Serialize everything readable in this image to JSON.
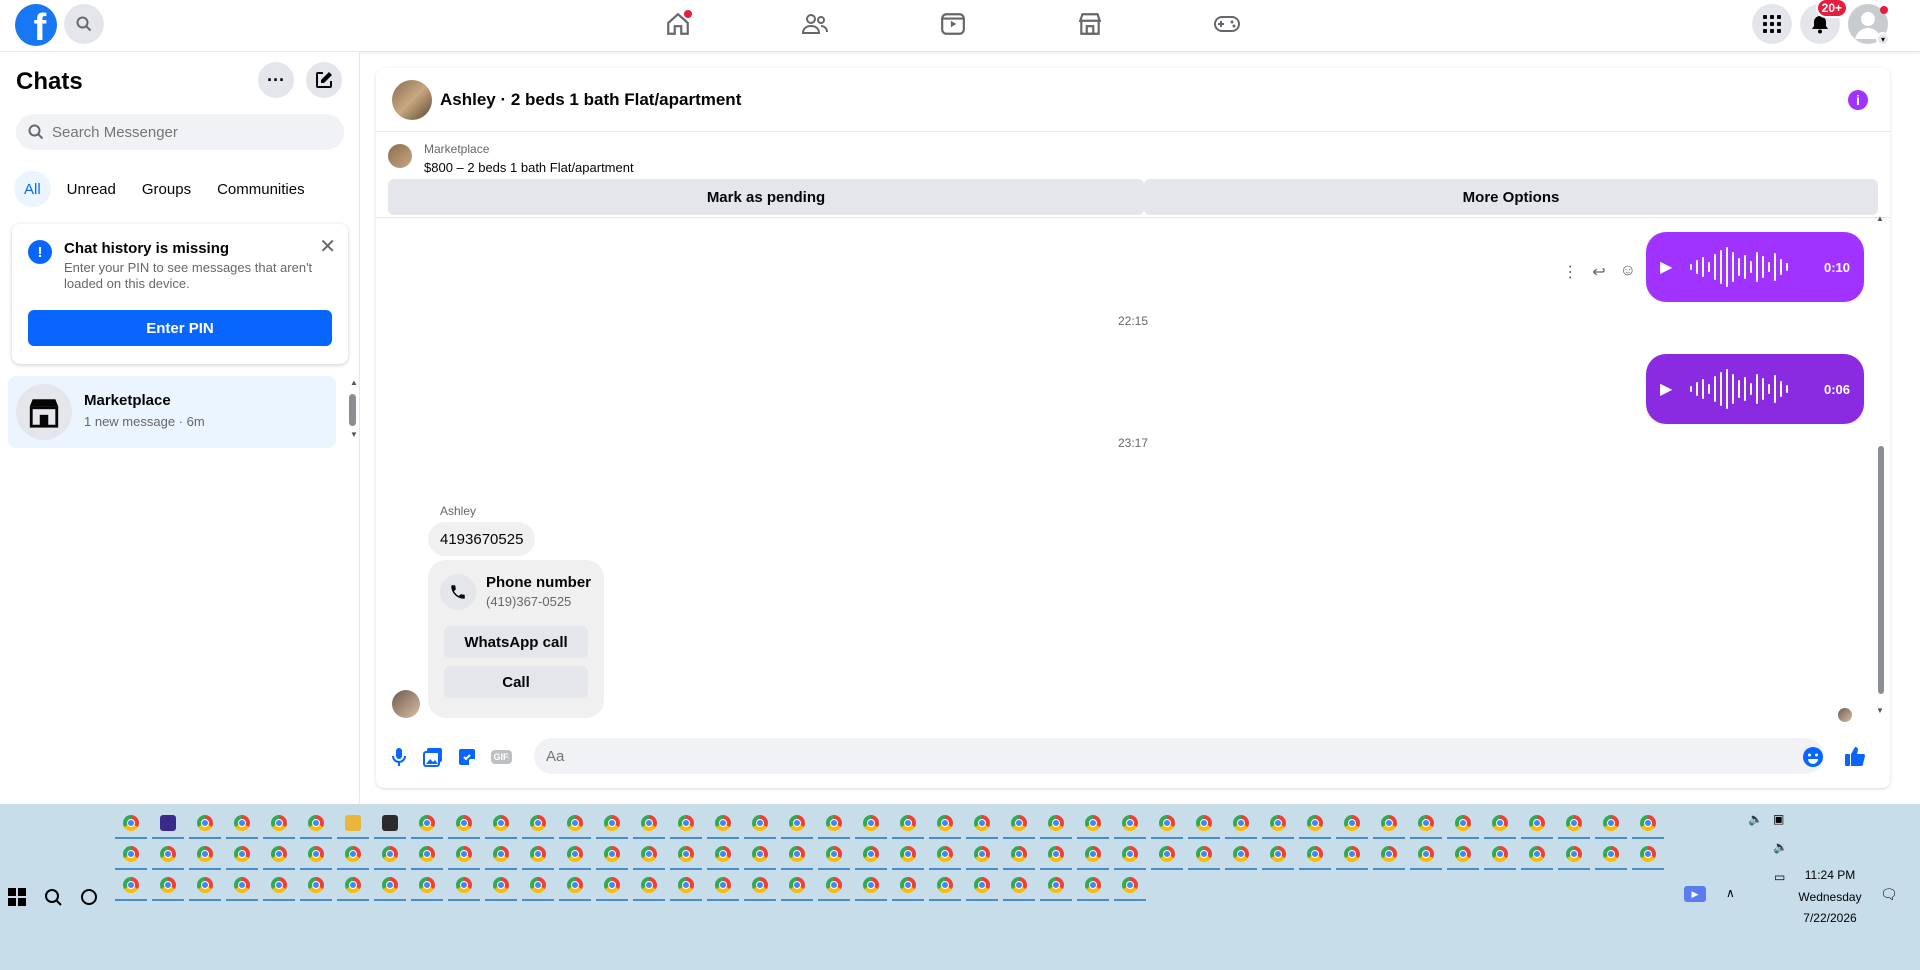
{
  "topbar": {
    "logo": "f",
    "notif_badge": "20+",
    "nav_icons": [
      "home-icon",
      "friends-icon",
      "watch-icon",
      "marketplace-icon",
      "gaming-icon"
    ]
  },
  "sidebar": {
    "title": "Chats",
    "search_placeholder": "Search Messenger",
    "filters": [
      "All",
      "Unread",
      "Groups",
      "Communities"
    ],
    "notice": {
      "title": "Chat history is missing",
      "text": "Enter your PIN to see messages that aren't loaded on this device.",
      "button": "Enter PIN"
    },
    "chat": {
      "name": "Marketplace",
      "sub": "1 new message · 6m"
    }
  },
  "conversation": {
    "title": "Ashley · 2 beds 1 bath Flat/apartment",
    "marketplace_label": "Marketplace",
    "listing": "$800 – 2 beds 1 bath Flat/apartment",
    "mark_pending": "Mark as pending",
    "more_options": "More Options",
    "voice1_duration": "0:10",
    "voice2_duration": "0:06",
    "time1": "22:15",
    "time2": "23:17",
    "sender": "Ashley",
    "message": "4193670525",
    "phone_title": "Phone number",
    "phone_number": "(419)367-0525",
    "whatsapp_call": "WhatsApp call",
    "call": "Call",
    "composer_placeholder": "Aa",
    "accent_color": "#a033ff"
  },
  "taskbar": {
    "time": "11:24 PM",
    "day": "Wednesday",
    "date": "7/22/2026"
  }
}
